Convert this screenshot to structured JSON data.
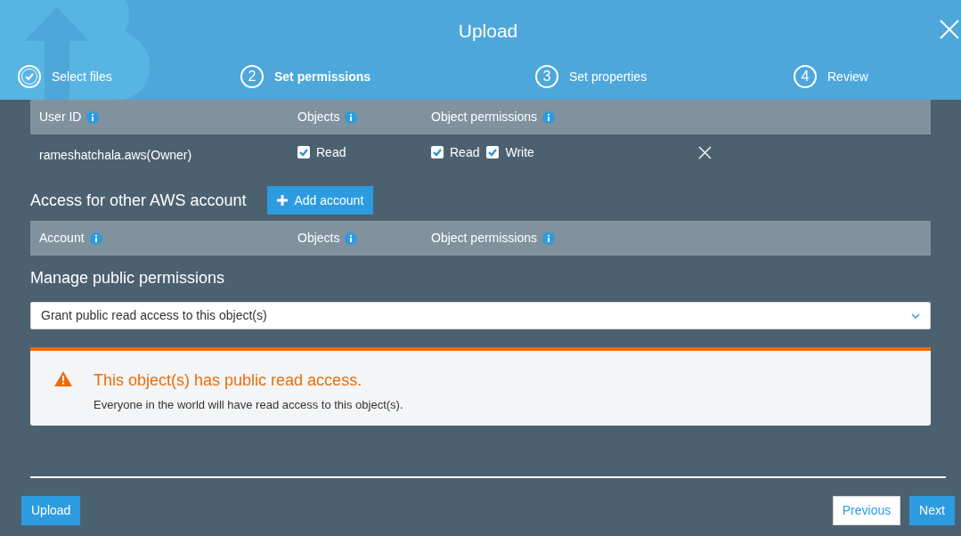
{
  "window": {
    "title": "Upload"
  },
  "steps": [
    {
      "kind": "completed",
      "label": "Select files",
      "selected": false
    },
    {
      "kind": "numbered",
      "number": "2",
      "label": "Set permissions",
      "selected": true
    },
    {
      "kind": "numbered",
      "number": "3",
      "label": "Set properties",
      "selected": false
    },
    {
      "kind": "numbered",
      "number": "4",
      "label": "Review",
      "selected": false
    }
  ],
  "owner_table": {
    "columns": [
      "User ID",
      "Objects",
      "Object permissions"
    ],
    "rows": [
      {
        "user_id": "rameshatchala.aws(Owner)",
        "objects": [
          {
            "label": "Read",
            "checked": true
          }
        ],
        "object_permissions": [
          {
            "label": "Read",
            "checked": true
          },
          {
            "label": "Write",
            "checked": true
          }
        ]
      }
    ]
  },
  "other_accounts": {
    "heading": "Access for other AWS account",
    "add_button": "Add account",
    "columns": [
      "Account",
      "Objects",
      "Object permissions"
    ]
  },
  "public_permissions": {
    "heading": "Manage public permissions",
    "value": "Grant public read access to this object(s)"
  },
  "alert": {
    "title": "This object(s) has public read access.",
    "message": "Everyone in the world will have read access to this object(s)."
  },
  "footer": {
    "upload_button": "Upload",
    "previous_button": "Previous",
    "next_button": "Next"
  }
}
